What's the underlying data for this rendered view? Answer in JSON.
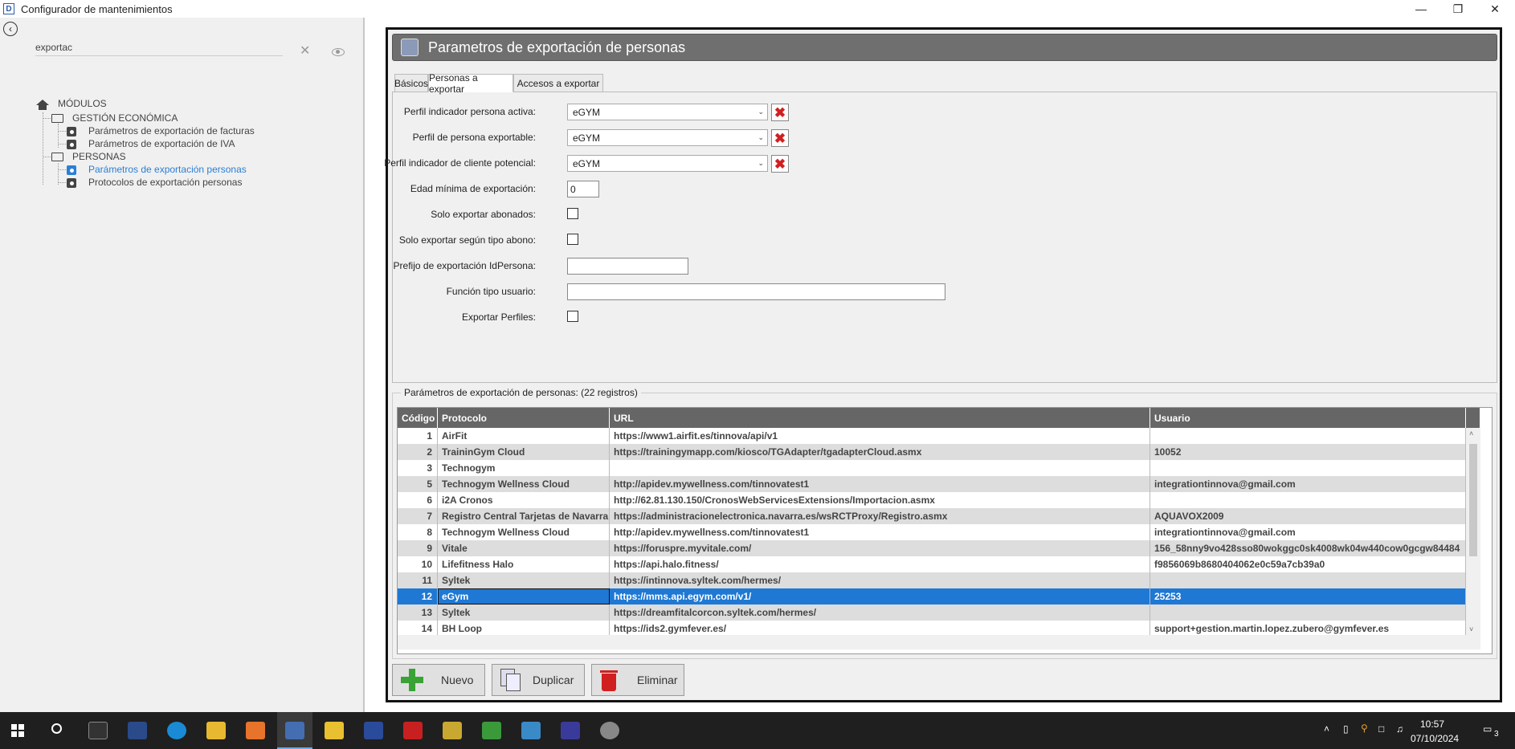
{
  "window": {
    "title": "Configurador de mantenimientos",
    "app_icon": "D"
  },
  "sidebar": {
    "search_value": "exportac",
    "tree": {
      "root": "MÓDULOS",
      "groups": [
        {
          "label": "GESTIÓN ECONÓMICA",
          "items": [
            "Parámetros de exportación de facturas",
            "Parámetros de exportación de IVA"
          ]
        },
        {
          "label": "PERSONAS",
          "items": [
            "Parámetros de exportación personas",
            "Protocolos de exportación personas"
          ]
        }
      ],
      "selected": "Parámetros de exportación personas"
    }
  },
  "header": {
    "title": "Parametros de exportación de personas"
  },
  "tabs": [
    "Básicos",
    "Personas a exportar",
    "Accesos a exportar"
  ],
  "active_tab": "Personas a exportar",
  "form": {
    "perfil_activa_label": "Perfil indicador persona activa:",
    "perfil_activa_value": "eGYM",
    "perfil_exportable_label": "Perfil de persona exportable:",
    "perfil_exportable_value": "eGYM",
    "perfil_potencial_label": "Perfil indicador de cliente potencial:",
    "perfil_potencial_value": "eGYM",
    "edad_label": "Edad mínima de exportación:",
    "edad_value": "0",
    "solo_abonados_label": "Solo exportar abonados:",
    "solo_tipo_label": "Solo exportar según tipo abono:",
    "prefijo_label": "Prefijo de exportación IdPersona:",
    "prefijo_value": "",
    "funcion_label": "Función tipo usuario:",
    "funcion_value": "",
    "exportar_perfiles_label": "Exportar Perfiles:"
  },
  "grid": {
    "legend": "Parámetros de exportación de personas:  (22 registros)",
    "columns": [
      "Código",
      "Protocolo",
      "URL",
      "Usuario"
    ],
    "rows": [
      {
        "codigo": "1",
        "protocolo": "AirFit",
        "url": "https://www1.airfit.es/tinnova/api/v1",
        "usuario": ""
      },
      {
        "codigo": "2",
        "protocolo": "TraininGym Cloud",
        "url": "https://trainingymapp.com/kiosco/TGAdapter/tgadapterCloud.asmx",
        "usuario": "10052"
      },
      {
        "codigo": "3",
        "protocolo": "Technogym",
        "url": "",
        "usuario": ""
      },
      {
        "codigo": "5",
        "protocolo": "Technogym Wellness Cloud",
        "url": "http://apidev.mywellness.com/tinnovatest1",
        "usuario": "integrationtinnova@gmail.com"
      },
      {
        "codigo": "6",
        "protocolo": "i2A Cronos",
        "url": "http://62.81.130.150/CronosWebServicesExtensions/Importacion.asmx",
        "usuario": ""
      },
      {
        "codigo": "7",
        "protocolo": "Registro Central Tarjetas de Navarra",
        "url": "https://administracionelectronica.navarra.es/wsRCTProxy/Registro.asmx",
        "usuario": "AQUAVOX2009"
      },
      {
        "codigo": "8",
        "protocolo": "Technogym Wellness Cloud",
        "url": "http://apidev.mywellness.com/tinnovatest1",
        "usuario": "integrationtinnova@gmail.com"
      },
      {
        "codigo": "9",
        "protocolo": "Vitale",
        "url": "https://foruspre.myvitale.com/",
        "usuario": "156_58nny9vo428sso80wokggc0sk4008wk04w440cow0gcgw84484"
      },
      {
        "codigo": "10",
        "protocolo": "Lifefitness Halo",
        "url": "https://api.halo.fitness/",
        "usuario": "f9856069b8680404062e0c59a7cb39a0"
      },
      {
        "codigo": "11",
        "protocolo": "Syltek",
        "url": "https://intinnova.syltek.com/hermes/",
        "usuario": ""
      },
      {
        "codigo": "12",
        "protocolo": "eGym",
        "url": "https://mms.api.egym.com/v1/",
        "usuario": "25253"
      },
      {
        "codigo": "13",
        "protocolo": "Syltek",
        "url": "https://dreamfitalcorcon.syltek.com/hermes/",
        "usuario": ""
      },
      {
        "codigo": "14",
        "protocolo": "BH Loop",
        "url": "https://ids2.gymfever.es/",
        "usuario": "support+gestion.martin.lopez.zubero@gymfever.es"
      }
    ],
    "selected_codigo": "12"
  },
  "buttons": {
    "nuevo": "Nuevo",
    "duplicar": "Duplicar",
    "eliminar": "Eliminar"
  },
  "taskbar": {
    "time": "10:57",
    "date": "07/10/2024",
    "notifications": "3"
  },
  "colors": {
    "header_bg": "#6f6f6f",
    "grid_header_bg": "#666666",
    "selection": "#1e78d4",
    "delete_red": "#d02020",
    "add_green": "#3aa335"
  }
}
